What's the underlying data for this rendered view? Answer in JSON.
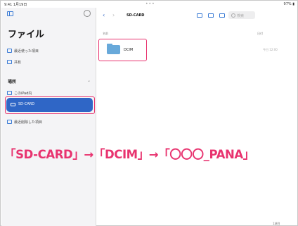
{
  "statusbar": {
    "time": "9:41 1月19日",
    "dots": "•••",
    "battery": "97% ▮"
  },
  "sidebar": {
    "title": "ファイル",
    "items": [
      {
        "label": "最近使った項目"
      },
      {
        "label": "共有"
      }
    ],
    "section_heading": "場所",
    "collapse": "⌄",
    "locations": [
      {
        "label": "このiPad内"
      },
      {
        "label": "SD-CARD"
      },
      {
        "label": "最近削除した項目"
      }
    ]
  },
  "main": {
    "back": "‹",
    "forward": "›",
    "title": "SD-CARD",
    "search_placeholder": "検索",
    "columns": {
      "name": "名前",
      "date": "日付"
    },
    "rows": [
      {
        "name": "DCIM",
        "date": "今日 12:00"
      }
    ],
    "footer": "1項目"
  },
  "caption": "「SD-CARD」→「DCIM」→「〇〇〇_PANA」",
  "colors": {
    "accent": "#2f66c6",
    "highlight": "#e8336f",
    "folder": "#68a9da"
  }
}
